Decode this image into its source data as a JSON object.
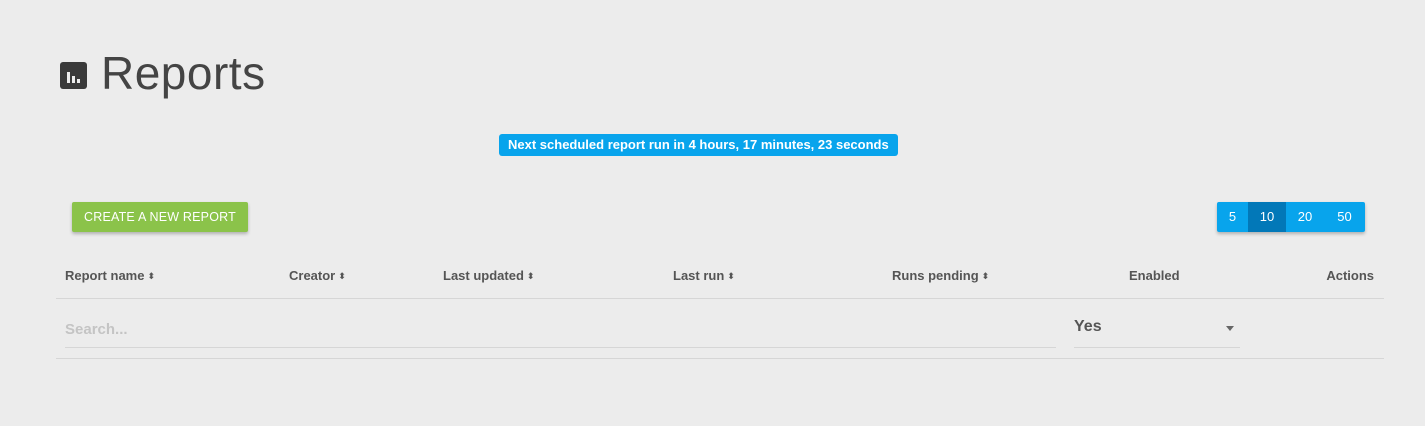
{
  "header": {
    "icon": "bar-chart-icon",
    "title": "Reports"
  },
  "schedule_banner": "Next scheduled report run in 4 hours, 17 minutes, 23 seconds",
  "create_button": "CREATE A NEW REPORT",
  "page_size": {
    "options": [
      "5",
      "10",
      "20",
      "50"
    ],
    "selected": "10"
  },
  "table": {
    "columns": {
      "report_name": "Report name",
      "creator": "Creator",
      "last_updated": "Last updated",
      "last_run": "Last run",
      "runs_pending": "Runs pending",
      "enabled": "Enabled",
      "actions": "Actions"
    },
    "sort_icon": "sort-icon"
  },
  "filters": {
    "search_placeholder": "Search...",
    "search_value": "",
    "enabled_value": "Yes"
  },
  "colors": {
    "background": "#ececec",
    "accent_blue": "#08a4ec",
    "active_blue": "#0278b8",
    "green": "#8bc34a"
  }
}
